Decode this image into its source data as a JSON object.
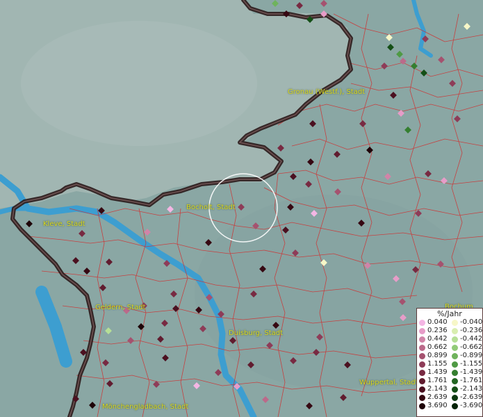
{
  "map": {
    "places": [
      {
        "key": "gronau",
        "name": "Gronau (Westf.), Stadt"
      },
      {
        "key": "bocholt",
        "name": "Bocholt, Stadt"
      },
      {
        "key": "kleve",
        "name": "Kleve, Stadt"
      },
      {
        "key": "geldern",
        "name": "Geldern, Stadt"
      },
      {
        "key": "duisburg",
        "name": "Duisburg, Stadt"
      },
      {
        "key": "wuppertal",
        "name": "Wuppertal, Stadt"
      },
      {
        "key": "moenchengladbach",
        "name": "Mönchengladbach, Stadt"
      },
      {
        "key": "bochum",
        "name": "Bochum"
      }
    ]
  },
  "legend": {
    "title": "%/Jahr",
    "positive": [
      {
        "value": "0.040",
        "color": "#f4b6e4"
      },
      {
        "value": "0.236",
        "color": "#e79cc8"
      },
      {
        "value": "0.442",
        "color": "#d184a8"
      },
      {
        "value": "0.662",
        "color": "#bb6a8a"
      },
      {
        "value": "0.899",
        "color": "#a5526f"
      },
      {
        "value": "1.155",
        "color": "#8e3c58"
      },
      {
        "value": "1.439",
        "color": "#782a42"
      },
      {
        "value": "1.761",
        "color": "#611c2f"
      },
      {
        "value": "2.143",
        "color": "#4b1020"
      },
      {
        "value": "2.639",
        "color": "#360812"
      },
      {
        "value": "3.690",
        "color": "#1e0308"
      }
    ],
    "negative": [
      {
        "value": "-0.040",
        "color": "#f7f7c8"
      },
      {
        "value": "-0.236",
        "color": "#d9eeb0"
      },
      {
        "value": "-0.442",
        "color": "#b6df96"
      },
      {
        "value": "-0.662",
        "color": "#92cb78"
      },
      {
        "value": "-0.899",
        "color": "#6fb35c"
      },
      {
        "value": "-1.155",
        "color": "#4f9a44"
      },
      {
        "value": "-1.439",
        "color": "#357f30"
      },
      {
        "value": "-1.761",
        "color": "#226622"
      },
      {
        "value": "-2.143",
        "color": "#144f16"
      },
      {
        "value": "-2.639",
        "color": "#0a380d"
      },
      {
        "value": "-3.690",
        "color": "#042306"
      }
    ]
  },
  "colors": {
    "land": "#8aa7a4",
    "sea_haze": "#9cb2ae",
    "river": "#3d9ed0",
    "district_border": "#d03030",
    "national_border": "#2a1a1a"
  }
}
